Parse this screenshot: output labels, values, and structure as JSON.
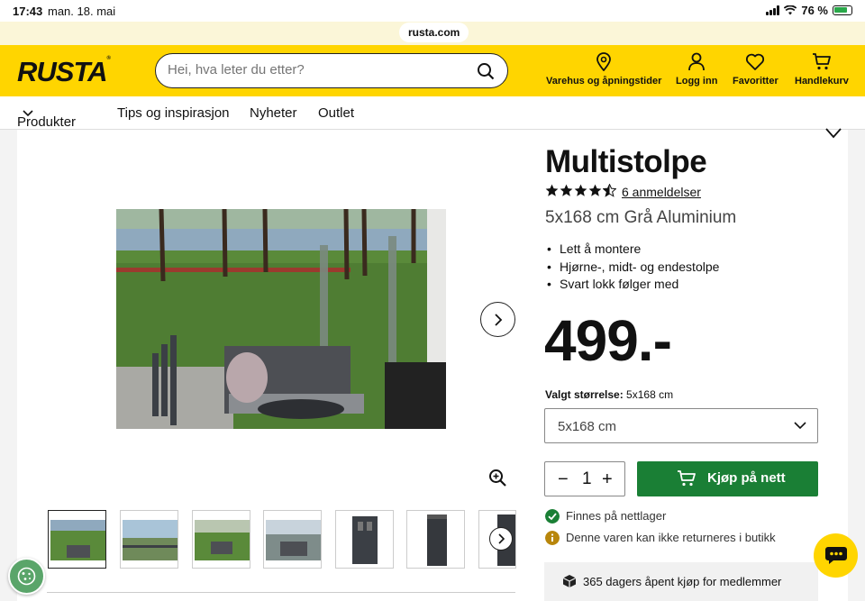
{
  "status_bar": {
    "time": "17:43",
    "date": "man. 18. mai",
    "battery": "76 %"
  },
  "browser": {
    "url": "rusta.com"
  },
  "header": {
    "logo": "RUSTA",
    "search_placeholder": "Hei, hva leter du etter?",
    "links": [
      {
        "label": "Varehus og åpningstider",
        "icon": "location-pin-icon"
      },
      {
        "label": "Logg inn",
        "icon": "user-icon"
      },
      {
        "label": "Favoritter",
        "icon": "heart-icon"
      },
      {
        "label": "Handlekurv",
        "icon": "cart-icon"
      }
    ]
  },
  "nav": {
    "items": [
      "Produkter",
      "Tips og inspirasjon",
      "Nyheter",
      "Outlet"
    ]
  },
  "product": {
    "title": "Multistolpe",
    "rating": 4.5,
    "reviews": "6 anmeldelser",
    "variant": "5x168 cm Grå Aluminium",
    "bullets": [
      "Lett å montere",
      "Hjørne-, midt- og endestolpe",
      "Svart lokk følger med"
    ],
    "price": "499.-",
    "size_label": "Valgt størrelse:",
    "size_value": "5x168 cm",
    "size_select": "5x168 cm",
    "quantity": "1",
    "buy_label": "Kjøp på nett",
    "stock_online": "Finnes på nettlager",
    "return_note": "Denne varen kan ikke returneres i butikk",
    "member_offer": "365 dagers åpent kjøp for medlemmer"
  },
  "gallery": {
    "thumbnail_count": 7,
    "selected_index": 0
  },
  "colors": {
    "brand_yellow": "#ffd500",
    "buy_green": "#1a7f35",
    "info_orange": "#b8860b"
  }
}
